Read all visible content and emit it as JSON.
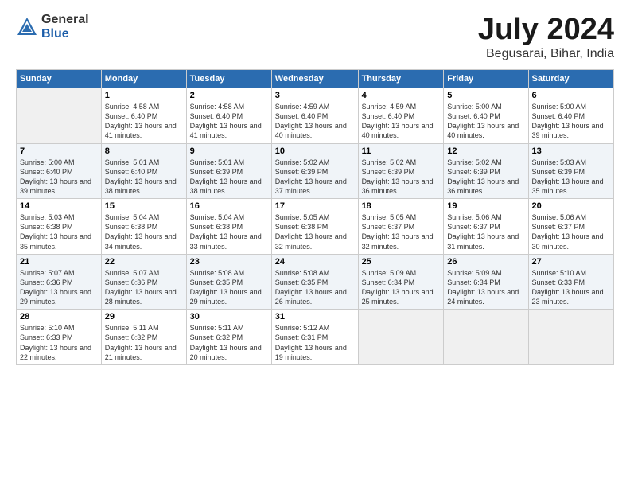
{
  "header": {
    "logo_general": "General",
    "logo_blue": "Blue",
    "title": "July 2024",
    "location": "Begusarai, Bihar, India"
  },
  "calendar": {
    "days_of_week": [
      "Sunday",
      "Monday",
      "Tuesday",
      "Wednesday",
      "Thursday",
      "Friday",
      "Saturday"
    ],
    "weeks": [
      [
        {
          "date": "",
          "sunrise": "",
          "sunset": "",
          "daylight": ""
        },
        {
          "date": "1",
          "sunrise": "Sunrise: 4:58 AM",
          "sunset": "Sunset: 6:40 PM",
          "daylight": "Daylight: 13 hours and 41 minutes."
        },
        {
          "date": "2",
          "sunrise": "Sunrise: 4:58 AM",
          "sunset": "Sunset: 6:40 PM",
          "daylight": "Daylight: 13 hours and 41 minutes."
        },
        {
          "date": "3",
          "sunrise": "Sunrise: 4:59 AM",
          "sunset": "Sunset: 6:40 PM",
          "daylight": "Daylight: 13 hours and 40 minutes."
        },
        {
          "date": "4",
          "sunrise": "Sunrise: 4:59 AM",
          "sunset": "Sunset: 6:40 PM",
          "daylight": "Daylight: 13 hours and 40 minutes."
        },
        {
          "date": "5",
          "sunrise": "Sunrise: 5:00 AM",
          "sunset": "Sunset: 6:40 PM",
          "daylight": "Daylight: 13 hours and 40 minutes."
        },
        {
          "date": "6",
          "sunrise": "Sunrise: 5:00 AM",
          "sunset": "Sunset: 6:40 PM",
          "daylight": "Daylight: 13 hours and 39 minutes."
        }
      ],
      [
        {
          "date": "7",
          "sunrise": "Sunrise: 5:00 AM",
          "sunset": "Sunset: 6:40 PM",
          "daylight": "Daylight: 13 hours and 39 minutes."
        },
        {
          "date": "8",
          "sunrise": "Sunrise: 5:01 AM",
          "sunset": "Sunset: 6:40 PM",
          "daylight": "Daylight: 13 hours and 38 minutes."
        },
        {
          "date": "9",
          "sunrise": "Sunrise: 5:01 AM",
          "sunset": "Sunset: 6:39 PM",
          "daylight": "Daylight: 13 hours and 38 minutes."
        },
        {
          "date": "10",
          "sunrise": "Sunrise: 5:02 AM",
          "sunset": "Sunset: 6:39 PM",
          "daylight": "Daylight: 13 hours and 37 minutes."
        },
        {
          "date": "11",
          "sunrise": "Sunrise: 5:02 AM",
          "sunset": "Sunset: 6:39 PM",
          "daylight": "Daylight: 13 hours and 36 minutes."
        },
        {
          "date": "12",
          "sunrise": "Sunrise: 5:02 AM",
          "sunset": "Sunset: 6:39 PM",
          "daylight": "Daylight: 13 hours and 36 minutes."
        },
        {
          "date": "13",
          "sunrise": "Sunrise: 5:03 AM",
          "sunset": "Sunset: 6:39 PM",
          "daylight": "Daylight: 13 hours and 35 minutes."
        }
      ],
      [
        {
          "date": "14",
          "sunrise": "Sunrise: 5:03 AM",
          "sunset": "Sunset: 6:38 PM",
          "daylight": "Daylight: 13 hours and 35 minutes."
        },
        {
          "date": "15",
          "sunrise": "Sunrise: 5:04 AM",
          "sunset": "Sunset: 6:38 PM",
          "daylight": "Daylight: 13 hours and 34 minutes."
        },
        {
          "date": "16",
          "sunrise": "Sunrise: 5:04 AM",
          "sunset": "Sunset: 6:38 PM",
          "daylight": "Daylight: 13 hours and 33 minutes."
        },
        {
          "date": "17",
          "sunrise": "Sunrise: 5:05 AM",
          "sunset": "Sunset: 6:38 PM",
          "daylight": "Daylight: 13 hours and 32 minutes."
        },
        {
          "date": "18",
          "sunrise": "Sunrise: 5:05 AM",
          "sunset": "Sunset: 6:37 PM",
          "daylight": "Daylight: 13 hours and 32 minutes."
        },
        {
          "date": "19",
          "sunrise": "Sunrise: 5:06 AM",
          "sunset": "Sunset: 6:37 PM",
          "daylight": "Daylight: 13 hours and 31 minutes."
        },
        {
          "date": "20",
          "sunrise": "Sunrise: 5:06 AM",
          "sunset": "Sunset: 6:37 PM",
          "daylight": "Daylight: 13 hours and 30 minutes."
        }
      ],
      [
        {
          "date": "21",
          "sunrise": "Sunrise: 5:07 AM",
          "sunset": "Sunset: 6:36 PM",
          "daylight": "Daylight: 13 hours and 29 minutes."
        },
        {
          "date": "22",
          "sunrise": "Sunrise: 5:07 AM",
          "sunset": "Sunset: 6:36 PM",
          "daylight": "Daylight: 13 hours and 28 minutes."
        },
        {
          "date": "23",
          "sunrise": "Sunrise: 5:08 AM",
          "sunset": "Sunset: 6:35 PM",
          "daylight": "Daylight: 13 hours and 29 minutes."
        },
        {
          "date": "24",
          "sunrise": "Sunrise: 5:08 AM",
          "sunset": "Sunset: 6:35 PM",
          "daylight": "Daylight: 13 hours and 26 minutes."
        },
        {
          "date": "25",
          "sunrise": "Sunrise: 5:09 AM",
          "sunset": "Sunset: 6:34 PM",
          "daylight": "Daylight: 13 hours and 25 minutes."
        },
        {
          "date": "26",
          "sunrise": "Sunrise: 5:09 AM",
          "sunset": "Sunset: 6:34 PM",
          "daylight": "Daylight: 13 hours and 24 minutes."
        },
        {
          "date": "27",
          "sunrise": "Sunrise: 5:10 AM",
          "sunset": "Sunset: 6:33 PM",
          "daylight": "Daylight: 13 hours and 23 minutes."
        }
      ],
      [
        {
          "date": "28",
          "sunrise": "Sunrise: 5:10 AM",
          "sunset": "Sunset: 6:33 PM",
          "daylight": "Daylight: 13 hours and 22 minutes."
        },
        {
          "date": "29",
          "sunrise": "Sunrise: 5:11 AM",
          "sunset": "Sunset: 6:32 PM",
          "daylight": "Daylight: 13 hours and 21 minutes."
        },
        {
          "date": "30",
          "sunrise": "Sunrise: 5:11 AM",
          "sunset": "Sunset: 6:32 PM",
          "daylight": "Daylight: 13 hours and 20 minutes."
        },
        {
          "date": "31",
          "sunrise": "Sunrise: 5:12 AM",
          "sunset": "Sunset: 6:31 PM",
          "daylight": "Daylight: 13 hours and 19 minutes."
        },
        {
          "date": "",
          "sunrise": "",
          "sunset": "",
          "daylight": ""
        },
        {
          "date": "",
          "sunrise": "",
          "sunset": "",
          "daylight": ""
        },
        {
          "date": "",
          "sunrise": "",
          "sunset": "",
          "daylight": ""
        }
      ]
    ]
  }
}
